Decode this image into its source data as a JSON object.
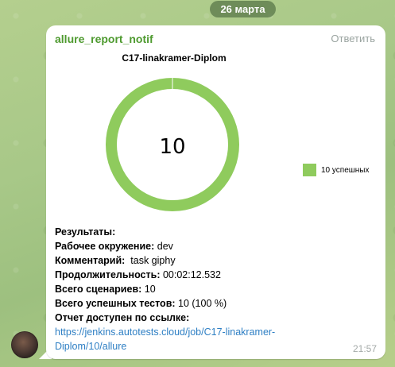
{
  "date_label": "26 марта",
  "message": {
    "sender": "allure_report_notif",
    "reply_label": "Ответить",
    "time": "21:57",
    "lines": [
      {
        "label": "Результаты:",
        "value": ""
      },
      {
        "label": "Рабочее окружение:",
        "value": " dev"
      },
      {
        "label": "Комментарий:",
        "value": "  task giphy"
      },
      {
        "label": "Продолжительность:",
        "value": " 00:02:12.532"
      },
      {
        "label": "Всего сценариев:",
        "value": " 10"
      },
      {
        "label": "Всего успешных тестов:",
        "value": " 10 (100 %)"
      },
      {
        "label": "Отчет доступен по ссылке:",
        "value": ""
      }
    ],
    "link_line1": "https://jenkins.autotests.cloud/job/C17-linakramer-",
    "link_line2": "Diplom/10/allure"
  },
  "chart_data": {
    "type": "pie",
    "title": "C17-linakramer-Diplom",
    "center_label": "10",
    "slices": [
      {
        "label": "10 успешных",
        "value": 10,
        "color": "#8fcb5d"
      }
    ],
    "legend_position": "right"
  }
}
